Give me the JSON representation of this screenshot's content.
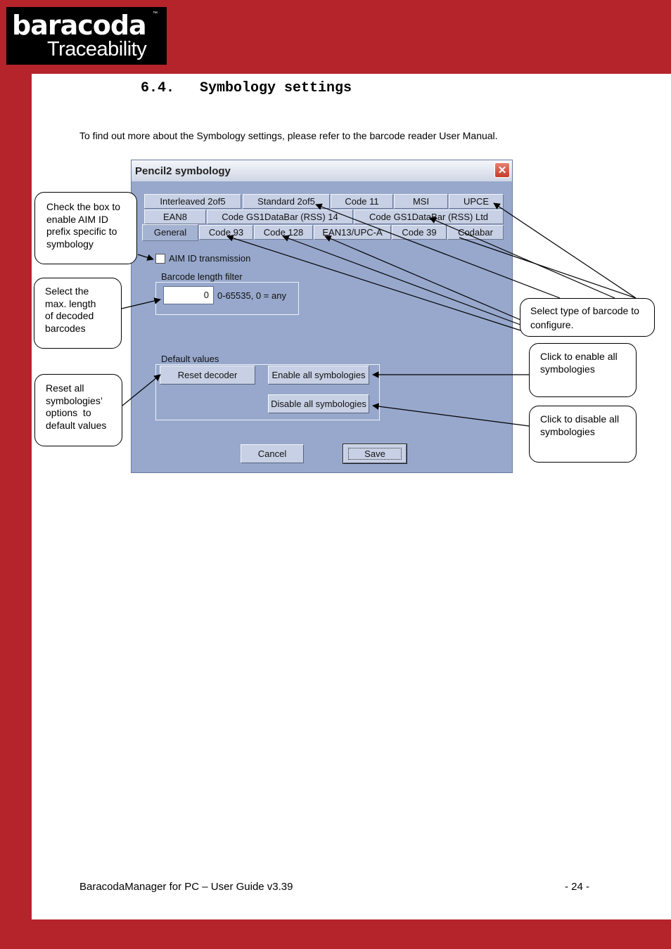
{
  "logo": {
    "brand": "baracoda",
    "tm": "™",
    "subtitle": "Traceability"
  },
  "heading": "6.4.   Symbology settings",
  "intro": "To find out more about the Symbology settings, please refer to the barcode reader User Manual.",
  "dialog": {
    "title": "Pencil2 symbology",
    "close_icon": "close-icon",
    "tabs_row1": [
      "Interleaved 2of5",
      "Standard 2of5",
      "Code 11",
      "MSI",
      "UPCE"
    ],
    "tabs_row2": [
      "EAN8",
      "Code GS1DataBar (RSS) 14",
      "Code GS1DataBar (RSS) Ltd"
    ],
    "tabs_row3": [
      "General",
      "Code 93",
      "Code 128",
      "EAN13/UPC-A",
      "Code 39",
      "Codabar"
    ],
    "active_tab": "General",
    "aim_checkbox_label": "AIM ID transmission",
    "aim_checked": false,
    "length_group_title": "Barcode length filter",
    "length_value": "0",
    "length_hint": "0-65535, 0 = any",
    "defaults_group_title": "Default values",
    "reset_button": "Reset decoder",
    "enable_button": "Enable all symbologies",
    "disable_button": "Disable all symbologies",
    "cancel_button": "Cancel",
    "save_button": "Save"
  },
  "callouts": {
    "aim": [
      "Check the box to",
      "enable AIM ID",
      "prefix specific to",
      "symbology"
    ],
    "maxlen": [
      "Select the",
      "max. length",
      "of decoded",
      "barcodes"
    ],
    "reset": [
      "Reset all",
      "symbologies’",
      "options  to",
      "default values"
    ],
    "type": [
      "Select type of barcode to",
      "configure."
    ],
    "enable": [
      "Click to enable all",
      "symbologies"
    ],
    "disable": [
      "Click to disable all",
      "symbologies"
    ]
  },
  "footer": {
    "left": "BaracodaManager for PC – User Guide v3.39",
    "right": "- 24 -"
  }
}
